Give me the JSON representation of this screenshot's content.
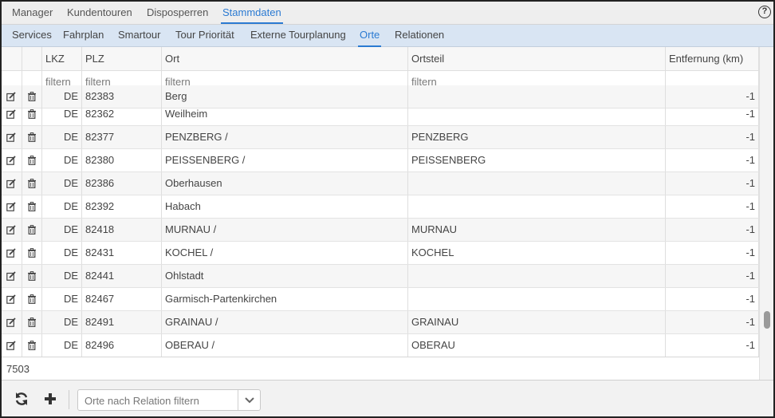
{
  "nav": {
    "tabs": [
      "Manager",
      "Kundentouren",
      "Disposperren",
      "Stammdaten"
    ],
    "active_tab": "Stammdaten",
    "help_label": "?"
  },
  "subnav": {
    "tabs": [
      "Services",
      "Fahrplan",
      "Smartour",
      "Tour Priorität",
      "Externe Tourplanung",
      "Orte",
      "Relationen"
    ],
    "active_tab": "Orte"
  },
  "table": {
    "columns": [
      "LKZ",
      "PLZ",
      "Ort",
      "Ortsteil",
      "Entfernung (km)"
    ],
    "filter_placeholder": "filtern",
    "partial_row": {
      "lkz": "DE",
      "plz": "82383",
      "ort": "Berg",
      "ortsteil": "",
      "entfernung": "-1"
    },
    "rows": [
      {
        "lkz": "DE",
        "plz": "82362",
        "ort": "Weilheim",
        "ortsteil": "",
        "entfernung": "-1"
      },
      {
        "lkz": "DE",
        "plz": "82377",
        "ort": "PENZBERG /",
        "ortsteil": "PENZBERG",
        "entfernung": "-1"
      },
      {
        "lkz": "DE",
        "plz": "82380",
        "ort": "PEISSENBERG /",
        "ortsteil": "PEISSENBERG",
        "entfernung": "-1"
      },
      {
        "lkz": "DE",
        "plz": "82386",
        "ort": "Oberhausen",
        "ortsteil": "",
        "entfernung": "-1"
      },
      {
        "lkz": "DE",
        "plz": "82392",
        "ort": "Habach",
        "ortsteil": "",
        "entfernung": "-1"
      },
      {
        "lkz": "DE",
        "plz": "82418",
        "ort": "MURNAU /",
        "ortsteil": "MURNAU",
        "entfernung": "-1"
      },
      {
        "lkz": "DE",
        "plz": "82431",
        "ort": "KOCHEL /",
        "ortsteil": "KOCHEL",
        "entfernung": "-1"
      },
      {
        "lkz": "DE",
        "plz": "82441",
        "ort": "Ohlstadt",
        "ortsteil": "",
        "entfernung": "-1"
      },
      {
        "lkz": "DE",
        "plz": "82467",
        "ort": "Garmisch-Partenkirchen",
        "ortsteil": "",
        "entfernung": "-1"
      },
      {
        "lkz": "DE",
        "plz": "82491",
        "ort": "GRAINAU /",
        "ortsteil": "GRAINAU",
        "entfernung": "-1"
      },
      {
        "lkz": "DE",
        "plz": "82496",
        "ort": "OBERAU /",
        "ortsteil": "OBERAU",
        "entfernung": "-1"
      }
    ],
    "row_icons": [
      "edit-icon",
      "trash-icon"
    ]
  },
  "status": {
    "count": "7503"
  },
  "footer": {
    "refresh_icon": "refresh-icon",
    "add_icon": "plus-icon",
    "relation_filter_placeholder": "Orte nach Relation filtern"
  },
  "colors": {
    "accent": "#2a7ad2",
    "subnav_bg": "#d9e5f3"
  }
}
